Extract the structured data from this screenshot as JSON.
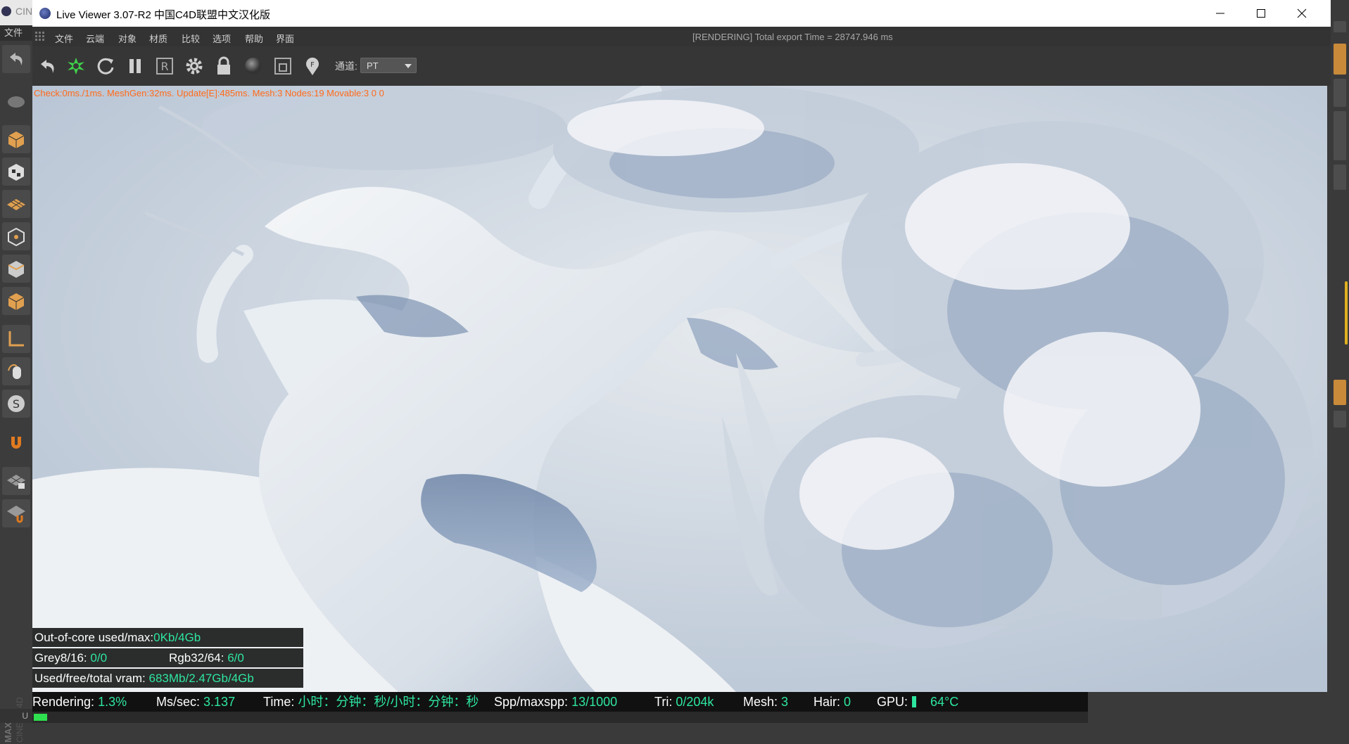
{
  "background_app": {
    "title_fragment": "CIN",
    "file_menu": "文件",
    "bottom_label": "U"
  },
  "window": {
    "title": "Live Viewer 3.07-R2 中国C4D联盟中文汉化版",
    "controls": [
      "minimize-icon",
      "maximize-icon",
      "close-icon"
    ]
  },
  "menu": {
    "items": [
      "文件",
      "云端",
      "对象",
      "材质",
      "比较",
      "选项",
      "帮助",
      "界面"
    ],
    "status": "[RENDERING] Total export Time = 28747.946 ms"
  },
  "toolbar": {
    "icons": [
      "undo-icon",
      "render-icon",
      "restart-icon",
      "pause-icon",
      "region-r-icon",
      "settings-gear-icon",
      "lock-icon",
      "sphere-icon",
      "frame-icon",
      "pin-f-icon",
      "pin-m-icon"
    ],
    "channel_label": "通道:",
    "channel_value": "PT"
  },
  "viewport": {
    "debug": "Check:0ms./1ms. MeshGen:32ms. Update[E]:485ms. Mesh:3 Nodes:19 Movable:3 0 0"
  },
  "stats": {
    "outofcore_label": "Out-of-core used/max:",
    "outofcore_value": "0Kb/4Gb",
    "grey_label": "Grey8/16:",
    "grey_value": "0/0",
    "rgb_label": "Rgb32/64:",
    "rgb_value": "6/0",
    "vram_label": "Used/free/total vram:",
    "vram_value": "683Mb/2.47Gb/4Gb"
  },
  "status_bar": {
    "rendering_label": "Rendering:",
    "rendering_value": "1.3%",
    "ms_label": "Ms/sec:",
    "ms_value": "3.137",
    "time_label": "Time:",
    "time_value": "小时：分钟：秒/小时：分钟：秒",
    "spp_label": "Spp/maxspp:",
    "spp_value": "13/1000",
    "tri_label": "Tri:",
    "tri_value": "0/204k",
    "mesh_label": "Mesh:",
    "mesh_value": "3",
    "hair_label": "Hair:",
    "hair_value": "0",
    "gpu_label": "GPU:",
    "gpu_temp": "64°C",
    "progress": 0.013
  },
  "colors": {
    "accent": "#2ee6a0",
    "debug": "#ff6a1a",
    "progress": "#2ee050"
  }
}
